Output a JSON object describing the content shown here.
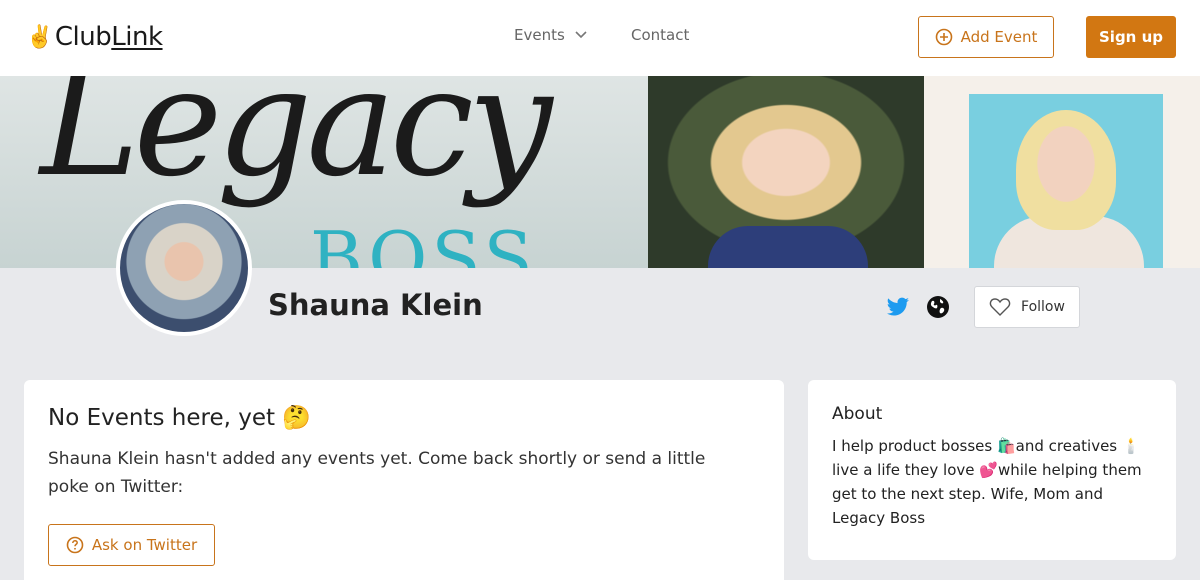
{
  "header": {
    "logo_prefix": "Club",
    "logo_suffix": "Link",
    "nav_events": "Events",
    "nav_contact": "Contact",
    "add_event_label": "Add Event",
    "signup_label": "Sign up"
  },
  "banner": {
    "script_text": "Legacy",
    "boss_text": "BOSS"
  },
  "profile": {
    "name": "Shauna Klein",
    "follow_label": "Follow"
  },
  "events_card": {
    "title": "No Events here, yet 🤔",
    "message": "Shauna Klein hasn't added any events yet. Come back shortly or send a little poke on Twitter:",
    "ask_label": "Ask on Twitter"
  },
  "about_card": {
    "title": "About",
    "bio": "I help product bosses 🛍️and creatives 🕯️ live a life they love 💕while helping them get to the next step. Wife, Mom and Legacy Boss"
  },
  "colors": {
    "accent": "#d27712",
    "twitter": "#1d9bf0",
    "background": "#e8e9ec"
  }
}
